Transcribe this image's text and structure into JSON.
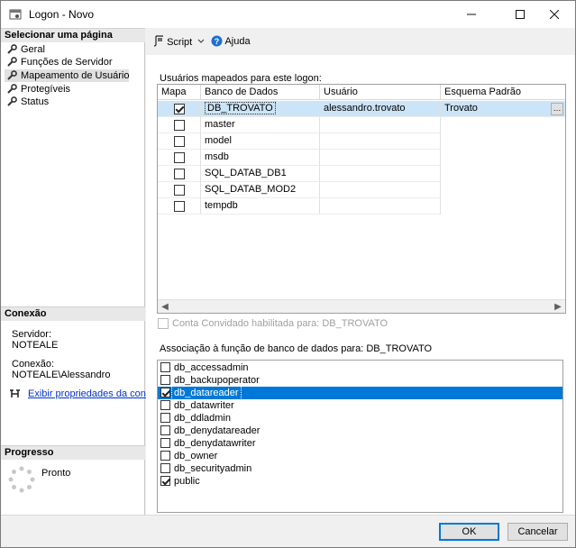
{
  "window": {
    "title": "Logon - Novo"
  },
  "sidebar": {
    "select_page_header": "Selecionar uma página",
    "pages": [
      {
        "label": "Geral"
      },
      {
        "label": "Funções de Servidor"
      },
      {
        "label": "Mapeamento de Usuário"
      },
      {
        "label": "Protegíveis"
      },
      {
        "label": "Status"
      }
    ],
    "connection_header": "Conexão",
    "server_label": "Servidor:",
    "server_value": "NOTEALE",
    "connection_label": "Conexão:",
    "connection_value": "NOTEALE\\Alessandro",
    "view_properties_link": "Exibir propriedades da conexã",
    "progress_header": "Progresso",
    "progress_status": "Pronto"
  },
  "toolbar": {
    "script_label": "Script",
    "help_label": "Ajuda"
  },
  "mapping": {
    "label": "Usuários mapeados para este logon:",
    "columns": [
      "Mapa",
      "Banco de Dados",
      "Usuário",
      "Esquema Padrão"
    ],
    "rows": [
      {
        "checked": true,
        "database": "DB_TROVATO",
        "user": "alessandro.trovato",
        "schema": "Trovato"
      },
      {
        "checked": false,
        "database": "master",
        "user": "",
        "schema": ""
      },
      {
        "checked": false,
        "database": "model",
        "user": "",
        "schema": ""
      },
      {
        "checked": false,
        "database": "msdb",
        "user": "",
        "schema": ""
      },
      {
        "checked": false,
        "database": "SQL_DATAB_DB1",
        "user": "",
        "schema": ""
      },
      {
        "checked": false,
        "database": "SQL_DATAB_MOD2",
        "user": "",
        "schema": ""
      },
      {
        "checked": false,
        "database": "tempdb",
        "user": "",
        "schema": ""
      }
    ]
  },
  "guest": {
    "label": "Conta Convidado habilitada para: DB_TROVATO"
  },
  "roles": {
    "label": "Associação à função de banco de dados para: DB_TROVATO",
    "items": [
      {
        "name": "db_accessadmin",
        "checked": false
      },
      {
        "name": "db_backupoperator",
        "checked": false
      },
      {
        "name": "db_datareader",
        "checked": true
      },
      {
        "name": "db_datawriter",
        "checked": false
      },
      {
        "name": "db_ddladmin",
        "checked": false
      },
      {
        "name": "db_denydatareader",
        "checked": false
      },
      {
        "name": "db_denydatawriter",
        "checked": false
      },
      {
        "name": "db_owner",
        "checked": false
      },
      {
        "name": "db_securityadmin",
        "checked": false
      },
      {
        "name": "public",
        "checked": true
      }
    ]
  },
  "buttons": {
    "ok": "OK",
    "cancel": "Cancelar"
  }
}
